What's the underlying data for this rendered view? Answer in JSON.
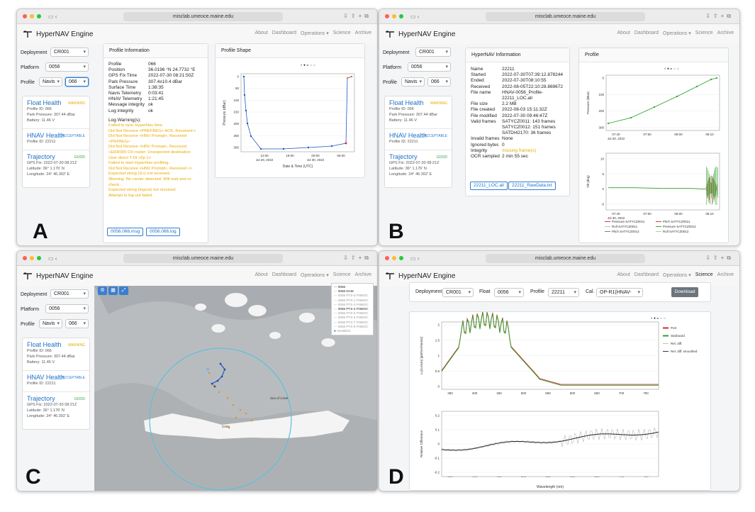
{
  "app": {
    "title": "HyperNAV Engine",
    "url": "misclab.umeoce.maine.edu",
    "nav": [
      "About",
      "Dashboard",
      "Operations ▾",
      "Science",
      "Archive"
    ]
  },
  "sidebar": {
    "deployment_label": "Deployment",
    "deployment": "CR001",
    "platform_label": "Platform",
    "platform": "0056",
    "profile_label": "Profile",
    "profile_type": "Navis",
    "profile": "066",
    "float_health": {
      "title": "Float Health",
      "badge": "WARNING",
      "lines": [
        "Profile ID: 066",
        "Park Pressure: 307.44 dBar",
        "Battery: 11.46 V"
      ]
    },
    "hnav_health": {
      "title": "HNAV Health",
      "badge": "ACCEPTABLE",
      "lines": [
        "Profile ID: 22211"
      ]
    },
    "trajectory": {
      "title": "Trajectory",
      "badge": "GOOD",
      "lines": [
        "GPS Fix: 2022-07-30 08:21Z",
        "Latitude: 36° 1.176' N",
        "Longitude: 24° 46.392' E"
      ]
    }
  },
  "panelA": {
    "title": "Profile Information",
    "rows": [
      [
        "Profile",
        "066"
      ],
      [
        "Position",
        "36.0196 °N 24.7732 °E"
      ],
      [
        "GPS Fix Time",
        "2022-07-30 08:21:50Z"
      ],
      [
        "Park Pressure",
        "307.4±10.4 dBar"
      ],
      [
        "Surface Time",
        "1:38:35"
      ],
      [
        "Navis Telemetry",
        "0:03:41"
      ],
      [
        "HNAV Telemetry",
        "1:21:45"
      ],
      [
        "Message integrity",
        "ok"
      ],
      [
        "Log integrity",
        "ok"
      ]
    ],
    "warn_title": "Log Warning(s):",
    "warnings": [
      "Failed to sync HyperNav time.",
      "Did Not Receive <PREFBEG> ACK, Received <",
      "Did Not Receive <HNV Prompt>, Received",
      "<PRFBEG>",
      "Did Not Receive <HNV Prompt>, Received",
      "<ERR005 OX router: Unexpected destination",
      "User direct T-Dt >5p 1>",
      "Failed to start HyperNav profiling.",
      "Did Not Receive <HNV Prompt>, Received <>",
      "Expected string (S>) not received.",
      "Warning: No carrier detected. Will wait and re-",
      "check...",
      "Expected string (logout) not received.",
      "Attempt to log-out failed."
    ],
    "buttons": [
      "0056.066.msg",
      "0056.066.log"
    ]
  },
  "shapeA": {
    "title": "Profile Shape",
    "ylabel": "Pressure (dBar)",
    "xlabel": "Date & Time (UTC)",
    "xticks": [
      "12:00",
      "18:00",
      "00:00",
      "06:00"
    ],
    "xsub": [
      "Jul 29, 2022",
      "",
      "Jul 30, 2022",
      ""
    ],
    "yticks": [
      "0",
      "50",
      "100",
      "150",
      "200",
      "250",
      "300"
    ]
  },
  "panelB": {
    "title": "HyperNAV Information",
    "rows": [
      [
        "Name",
        "22211"
      ],
      [
        "Started",
        "2022-07-30T07:39:12.878244"
      ],
      [
        "Ended",
        "2022-07-30T08:10:55"
      ],
      [
        "Received",
        "2022-08-05T22:10:28.869672"
      ],
      [
        "File name",
        "HNAV-0056_Profile-"
      ],
      [
        "",
        "22211_LOC.all"
      ],
      [
        "File size",
        "2.2 MB"
      ],
      [
        "File created",
        "2022-08-03 15:11:32Z"
      ],
      [
        "File modified",
        "2022-07-30 09:46:47Z"
      ],
      [
        "Valid frames",
        "SATYCZ0011: 143 frames"
      ],
      [
        "",
        "SATYCZ0012: 151 frames"
      ],
      [
        "",
        "SATDI42170: 36 frames"
      ],
      [
        "Invalid frames",
        "None"
      ],
      [
        "Ignored bytes",
        "0"
      ],
      [
        "Integrity",
        "missing frame(s)"
      ],
      [
        "OCR sampled",
        "2 min 55 sec"
      ]
    ],
    "buttons": [
      "22211_LOC.all",
      "22211_RawData.txt"
    ]
  },
  "profileB": {
    "title": "Profile",
    "ylabel_top": "Pressure (dBar)",
    "ylabel_bot": "Tilt (deg)",
    "xticks": [
      "07:40",
      "07:50",
      "08:00",
      "08:10"
    ],
    "xsub": "Jul 30, 2022",
    "yticks_top": [
      "0",
      "100",
      "200",
      "300"
    ],
    "yticks_bot": [
      "10",
      "5",
      "0",
      "-5"
    ],
    "legend": [
      "Pressure SATYCZ0011",
      "Pitch SATYCZ0011",
      "Roll SATYCZ0011",
      "Pressure SATYCZ0012",
      "Pitch SATYCZ0012",
      "Roll SATYCZ0012"
    ]
  },
  "mapC": {
    "layers": [
      "0056",
      "0056 DAM",
      "0056 PTS-0 FNMOC",
      "0056 PTS-1 FNMOC",
      "0056 PTS-3 FNMOC",
      "0056 PTS-4 FNMOC",
      "0056 PTS-5 FNMOC",
      "0056 PTS-6 FNMOC",
      "0056 PTS-7 FNMOC",
      "0056 PTS-8 FNMOC",
      "Heraklion"
    ],
    "sea_label": "Sea of Crete",
    "place": "Crete"
  },
  "sciD": {
    "deployment_label": "Deployment",
    "deployment": "CR001",
    "float_label": "Float",
    "float": "0056",
    "profile_label": "Profile",
    "profile": "22211",
    "cal_label": "Cal.",
    "cal": "OP-R1(HNAV-0056...",
    "download": "Download",
    "ylabel_top": "Lu(λ=0cm) [µW/cm²/nm/sr]",
    "ylabel_bot": "Relative Difference",
    "xlabel": "Wavelength (nm)",
    "legend": [
      "Port",
      "Starboard",
      "Rel. diff.",
      "Rel. diff. smoothed"
    ],
    "xticks": [
      "350",
      "400",
      "450",
      "500",
      "550",
      "600",
      "650",
      "700",
      "750"
    ],
    "yticks_top": [
      "2",
      "1.5",
      "1",
      "0.5",
      "0"
    ],
    "yticks_bot": [
      "0.2",
      "0.1",
      "0",
      "-0.1",
      "-0.2"
    ]
  },
  "labels": [
    "A",
    "B",
    "C",
    "D"
  ],
  "colors": {
    "accent": "#2d7dd2",
    "warn": "#e8a900",
    "good": "#2ea84b",
    "plot_green": "#2ca02c",
    "plot_red": "#d62728",
    "blue": "#1f4fb5"
  }
}
